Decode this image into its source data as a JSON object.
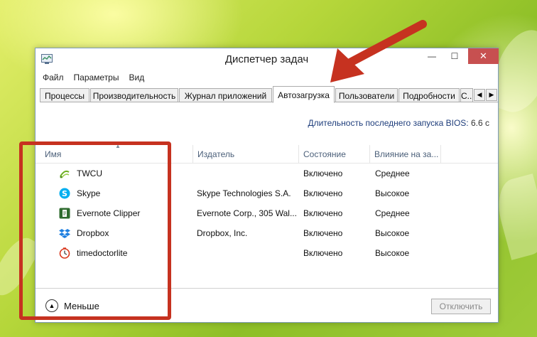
{
  "window": {
    "title": "Диспетчер задач",
    "controls": {
      "minimize": "—",
      "maximize": "☐",
      "close": "✕"
    }
  },
  "menu": [
    "Файл",
    "Параметры",
    "Вид"
  ],
  "tabs": [
    "Процессы",
    "Производительность",
    "Журнал приложений",
    "Автозагрузка",
    "Пользователи",
    "Подробности",
    "С..."
  ],
  "active_tab": "Автозагрузка",
  "bios": {
    "label": "Длительность последнего запуска BIOS:",
    "value": "6.6 с"
  },
  "columns": {
    "name": "Имя",
    "publisher": "Издатель",
    "state": "Состояние",
    "impact": "Влияние на за..."
  },
  "rows": [
    {
      "name": "TWCU",
      "publisher": "",
      "state": "Включено",
      "impact": "Среднее",
      "icon": "twcu-icon"
    },
    {
      "name": "Skype",
      "publisher": "Skype Technologies S.A.",
      "state": "Включено",
      "impact": "Высокое",
      "icon": "skype-icon"
    },
    {
      "name": "Evernote Clipper",
      "publisher": "Evernote Corp., 305 Wal...",
      "state": "Включено",
      "impact": "Среднее",
      "icon": "evernote-icon"
    },
    {
      "name": "Dropbox",
      "publisher": "Dropbox, Inc.",
      "state": "Включено",
      "impact": "Высокое",
      "icon": "dropbox-icon"
    },
    {
      "name": "timedoctorlite",
      "publisher": "",
      "state": "Включено",
      "impact": "Высокое",
      "icon": "timedoctor-icon"
    }
  ],
  "footer": {
    "less_label": "Меньше",
    "disable_label": "Отключить"
  },
  "colors": {
    "accent_red": "#c63220",
    "close_button": "#c75050",
    "header_text": "#4c607a"
  }
}
